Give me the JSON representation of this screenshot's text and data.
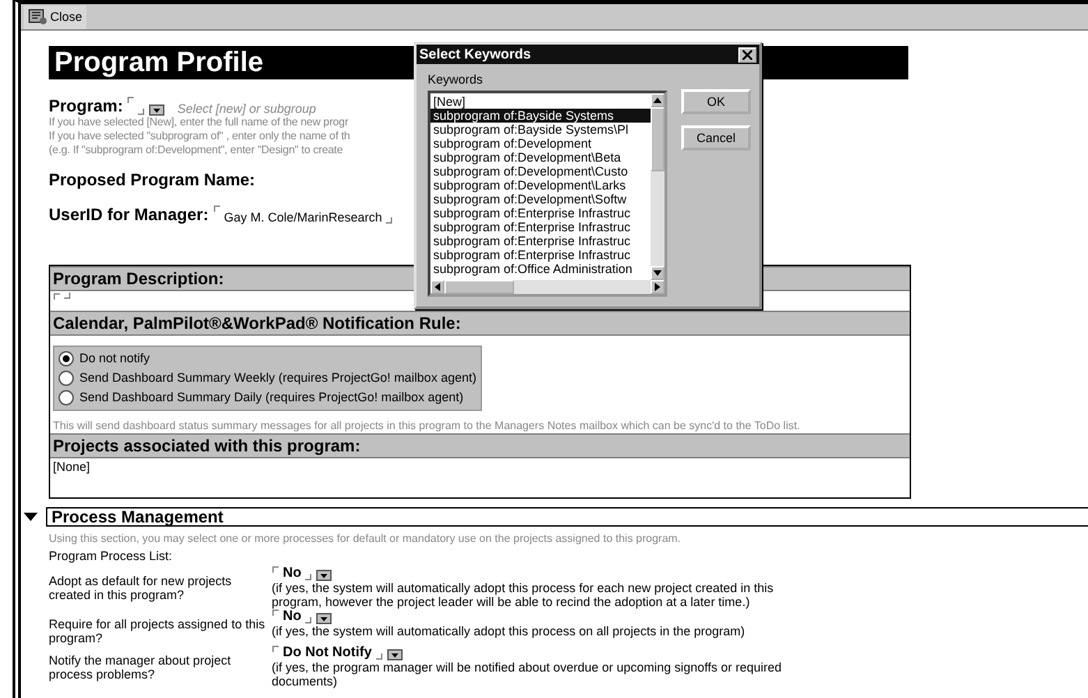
{
  "toolbar": {
    "close_button": "Close"
  },
  "title": "Program Profile",
  "program": {
    "label": "Program:",
    "hint": "Select [new] or subgroup",
    "help_lines": [
      "If you have selected [New], enter the full name of the new progr",
      "If you have selected \"subprogram of\" , enter only the name of th",
      "(e.g.  If \"subprogram of:Development\", enter \"Design\" to create"
    ]
  },
  "proposed_name": {
    "label": "Proposed Program Name:"
  },
  "manager": {
    "label": "UserID for Manager:",
    "value": "Gay M. Cole/MarinResearch"
  },
  "description": {
    "header": "Program Description:"
  },
  "notification": {
    "header": "Calendar, PalmPilot®&WorkPad® Notification Rule:",
    "options": [
      {
        "label": "Do not notify",
        "selected": true
      },
      {
        "label": "Send Dashboard Summary Weekly (requires ProjectGo! mailbox agent)",
        "selected": false
      },
      {
        "label": "Send Dashboard Summary Daily (requires ProjectGo! mailbox agent)",
        "selected": false
      }
    ],
    "note": "This will send dashboard status summary messages for all projects in this program to the Managers Notes mailbox which can be sync'd to the ToDo list."
  },
  "projects": {
    "header": "Projects associated with this program:",
    "value": "[None]"
  },
  "process": {
    "header": "Process Management",
    "expanded": true,
    "intro": "Using this section, you may select one or more processes for default or mandatory use on the projects assigned to this program.",
    "list_label": "Program Process List:",
    "rows": [
      {
        "question": "Adopt as default for new projects created in this program?",
        "value": "No",
        "note": "(if yes, the system will automatically adopt this process for each new project created in this program, however the project leader will be able to recind the adoption at a later time.)"
      },
      {
        "question": "Require for all projects assigned to this program?",
        "value": "No",
        "note": "(if yes, the system will automatically adopt this process on all projects in the program)"
      },
      {
        "question": "Notify the manager about project process problems?",
        "value": "Do Not Notify",
        "note": "(if yes, the program manager will be notified about overdue or upcoming signoffs or required documents)"
      }
    ]
  },
  "dialog": {
    "title": "Select Keywords",
    "list_label": "Keywords",
    "items": [
      {
        "label": "[New]",
        "selected": false
      },
      {
        "label": "subprogram of:Bayside Systems",
        "selected": true
      },
      {
        "label": "subprogram of:Bayside Systems\\Pl",
        "selected": false
      },
      {
        "label": "subprogram of:Development",
        "selected": false
      },
      {
        "label": "subprogram of:Development\\Beta",
        "selected": false
      },
      {
        "label": "subprogram of:Development\\Custo",
        "selected": false
      },
      {
        "label": "subprogram of:Development\\Larks",
        "selected": false
      },
      {
        "label": "subprogram of:Development\\Softw",
        "selected": false
      },
      {
        "label": "subprogram of:Enterprise Infrastruc",
        "selected": false
      },
      {
        "label": "subprogram of:Enterprise Infrastruc",
        "selected": false
      },
      {
        "label": "subprogram of:Enterprise Infrastruc",
        "selected": false
      },
      {
        "label": "subprogram of:Enterprise Infrastruc",
        "selected": false
      },
      {
        "label": "subprogram of:Office Administration",
        "selected": false
      }
    ],
    "buttons": [
      "OK",
      "Cancel"
    ]
  }
}
